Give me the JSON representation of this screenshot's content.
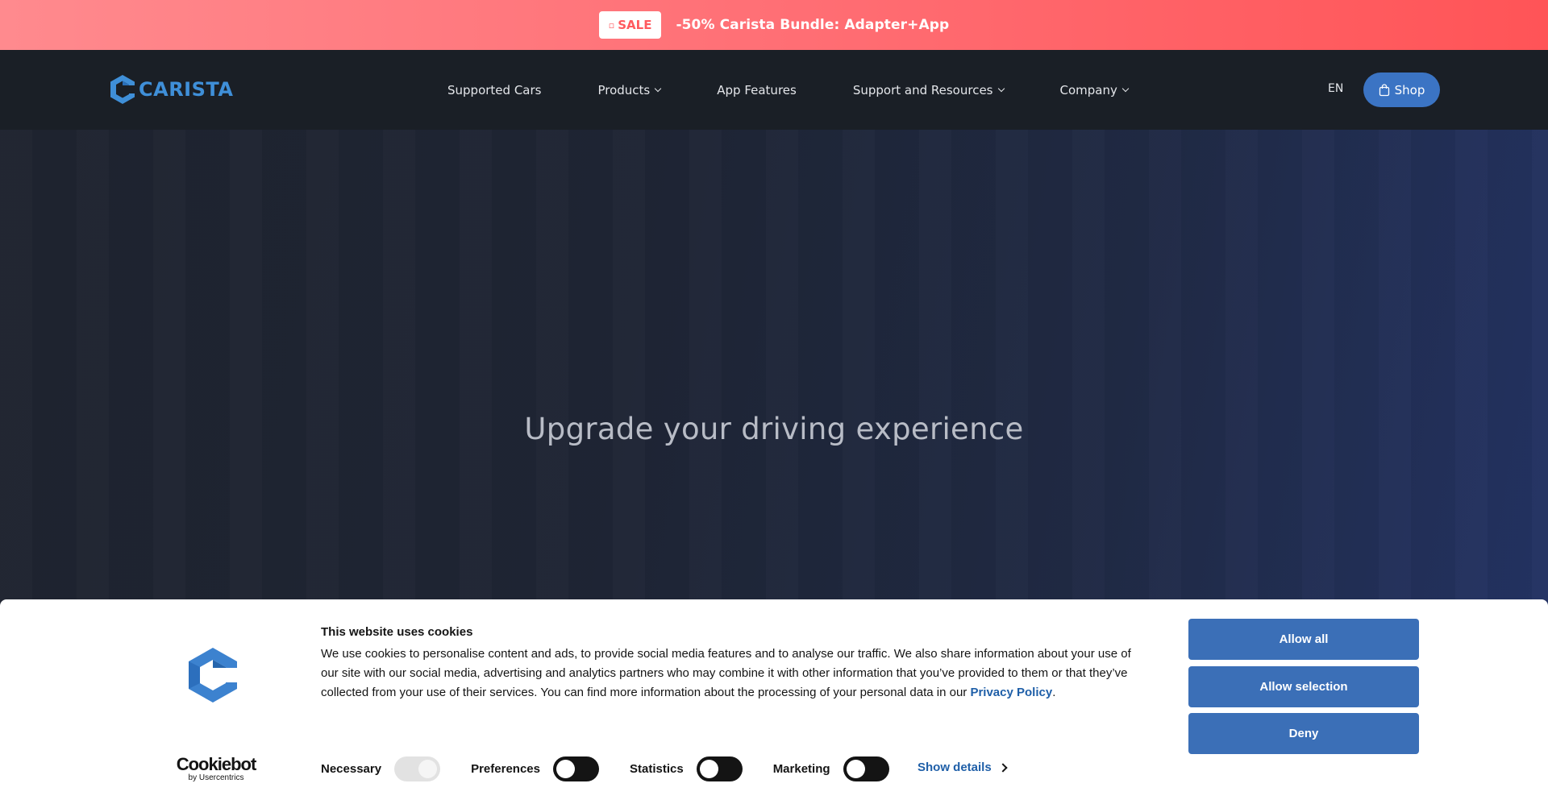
{
  "promo": {
    "badge_icon": "tag-icon",
    "badge_label": "SALE",
    "text": "-50% Carista Bundle: Adapter+App"
  },
  "header": {
    "logo_text": "CARISTA",
    "nav": [
      {
        "label": "Supported Cars",
        "has_dropdown": false
      },
      {
        "label": "Products",
        "has_dropdown": true
      },
      {
        "label": "App Features",
        "has_dropdown": false
      },
      {
        "label": "Support and Resources",
        "has_dropdown": true
      },
      {
        "label": "Company",
        "has_dropdown": true
      }
    ],
    "language": "EN",
    "shop_label": "Shop",
    "shop_icon": "shopping-bag-icon"
  },
  "hero": {
    "title": "Upgrade your driving experience"
  },
  "cookie": {
    "title": "This website uses cookies",
    "text": "We use cookies to personalise content and ads, to provide social media features and to analyse our traffic. We also share information about your use of our site with our social media, advertising and analytics partners who may combine it with other information that you’ve provided to them or that they’ve collected from your use of their services. You can find more information about the processing of your personal data in our",
    "link_text": "Privacy Policy",
    "link_suffix": ".",
    "brand_main": "Cookiebot",
    "brand_sub": "by Usercentrics",
    "toggles": [
      {
        "label": "Necessary",
        "state": "on-disabled"
      },
      {
        "label": "Preferences",
        "state": "off"
      },
      {
        "label": "Statistics",
        "state": "off"
      },
      {
        "label": "Marketing",
        "state": "off"
      }
    ],
    "show_details": "Show details",
    "buttons": {
      "allow_all": "Allow all",
      "allow_selection": "Allow selection",
      "deny": "Deny"
    }
  },
  "colors": {
    "promo_gradient_start": "#ff8a8e",
    "promo_gradient_end": "#ff5457",
    "header_bg": "#1a1f26",
    "brand_blue": "#3f8fd8",
    "button_blue": "#3b6fb7",
    "link_blue": "#1f5fa8"
  }
}
